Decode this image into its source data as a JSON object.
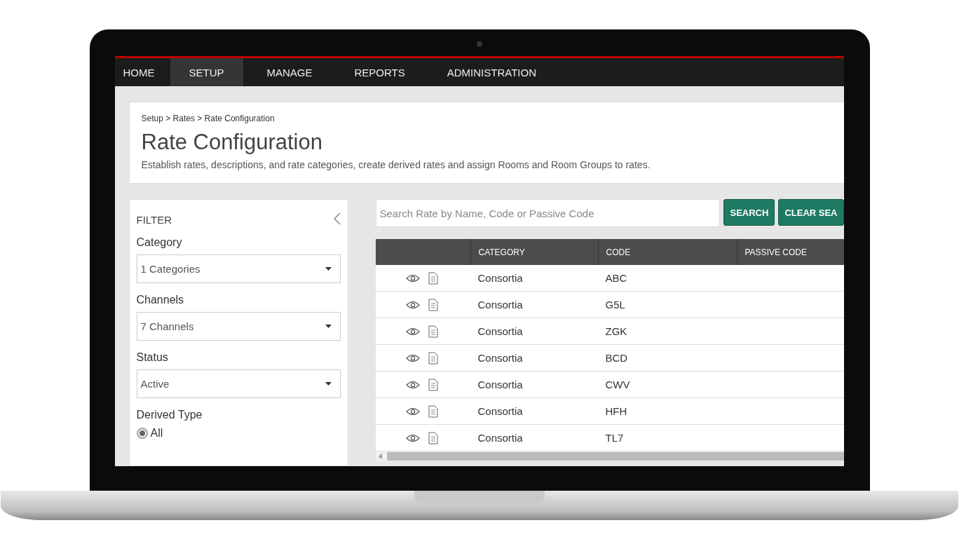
{
  "nav": {
    "tabs": [
      {
        "label": "HOME",
        "selected": false
      },
      {
        "label": "SETUP",
        "selected": true
      },
      {
        "label": "MANAGE",
        "selected": false
      },
      {
        "label": "REPORTS",
        "selected": false
      },
      {
        "label": "ADMINISTRATION",
        "selected": false
      }
    ]
  },
  "header": {
    "breadcrumb": "Setup > Rates > Rate Configuration",
    "title": "Rate Configuration",
    "description": "Establish rates, descriptions, and rate categories, create derived rates and assign Rooms and Room Groups to rates."
  },
  "filter": {
    "title": "FILTER",
    "dropdowns": [
      {
        "label": "Category",
        "value": "1 Categories"
      },
      {
        "label": "Channels",
        "value": "7 Channels"
      },
      {
        "label": "Status",
        "value": "Active"
      }
    ],
    "derived_type": {
      "label": "Derived Type",
      "options": [
        {
          "label": "All",
          "selected": true
        }
      ]
    }
  },
  "search": {
    "placeholder": "Search Rate by Name, Code or Passive Code",
    "buttons": [
      "SEARCH",
      "CLEAR SEA"
    ]
  },
  "table": {
    "columns": [
      "CATEGORY",
      "CODE",
      "PASSIVE CODE"
    ],
    "rows": [
      {
        "category": "Consortia",
        "code": "ABC"
      },
      {
        "category": "Consortia",
        "code": "G5L"
      },
      {
        "category": "Consortia",
        "code": "ZGK"
      },
      {
        "category": "Consortia",
        "code": "BCD"
      },
      {
        "category": "Consortia",
        "code": "CWV"
      },
      {
        "category": "Consortia",
        "code": "HFH"
      },
      {
        "category": "Consortia",
        "code": "TL7"
      }
    ]
  }
}
